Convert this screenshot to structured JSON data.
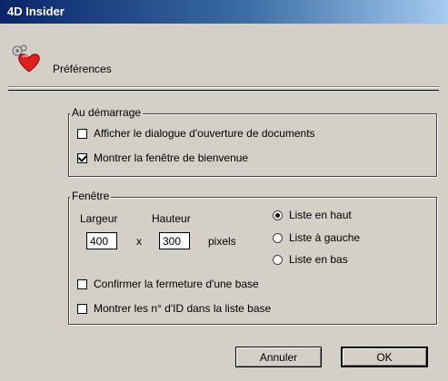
{
  "window": {
    "title": "4D Insider"
  },
  "header": {
    "title": "Préférences",
    "icon": "preferences-heart-icon"
  },
  "startup": {
    "legend": "Au démarrage",
    "options": [
      {
        "label": "Afficher le dialogue d'ouverture de documents",
        "checked": false
      },
      {
        "label": "Montrer la fenêtre de bienvenue",
        "checked": true
      }
    ]
  },
  "window_group": {
    "legend": "Fenêtre",
    "width_label": "Largeur",
    "height_label": "Hauteur",
    "width_value": "400",
    "height_value": "300",
    "times": "x",
    "unit": "pixels",
    "list_position": {
      "options": [
        {
          "label": "Liste en haut",
          "selected": true
        },
        {
          "label": "Liste à gauche",
          "selected": false
        },
        {
          "label": "Liste en bas",
          "selected": false
        }
      ]
    },
    "options": [
      {
        "label": "Confirmer la fermeture d'une base",
        "checked": false
      },
      {
        "label": "Montrer les n° d'ID dans la liste base",
        "checked": false
      }
    ]
  },
  "buttons": {
    "cancel": "Annuler",
    "ok": "OK"
  }
}
